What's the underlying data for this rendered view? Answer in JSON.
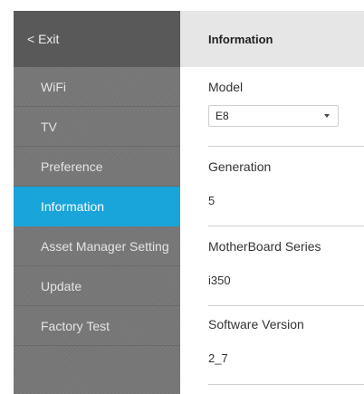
{
  "sidebar": {
    "exit_label": "< Exit",
    "items": [
      {
        "label": "WiFi"
      },
      {
        "label": "TV"
      },
      {
        "label": "Preference"
      },
      {
        "label": "Information"
      },
      {
        "label": "Asset Manager Setting"
      },
      {
        "label": "Update"
      },
      {
        "label": "Factory Test"
      }
    ],
    "active": "Information"
  },
  "main": {
    "title": "Information",
    "model": {
      "label": "Model",
      "value": "E8"
    },
    "generation": {
      "label": "Generation",
      "value": "5"
    },
    "motherboard": {
      "label": "MotherBoard Series",
      "value": "i350"
    },
    "software": {
      "label": "Software Version",
      "value": "2_7"
    }
  },
  "colors": {
    "sidebar_bg": "#777777",
    "sidebar_header_bg": "#595959",
    "active_item_bg": "#1aa5da",
    "main_header_bg": "#e6e6e6"
  }
}
